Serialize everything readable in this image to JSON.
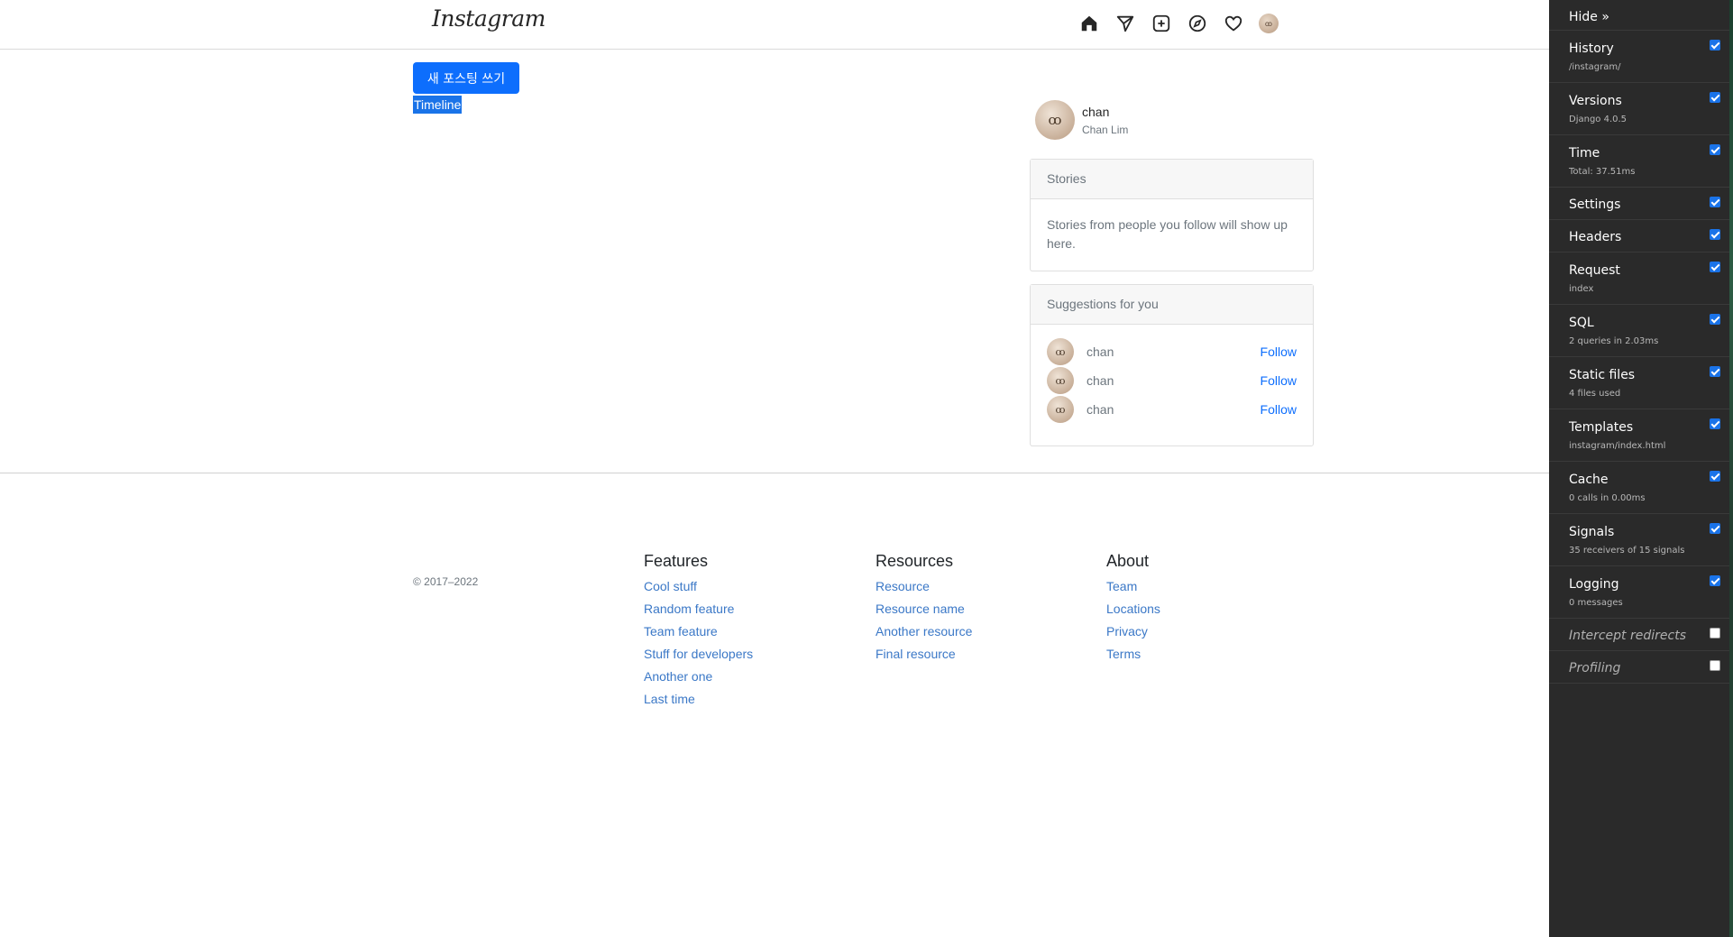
{
  "navbar": {
    "logo": "Instagram",
    "icons": [
      "home-icon",
      "send-icon",
      "plus-square-icon",
      "compass-icon",
      "heart-icon",
      "profile-avatar"
    ]
  },
  "main": {
    "new_post_button": "새 포스팅 쓰기",
    "timeline_label": "Timeline"
  },
  "profile": {
    "username": "chan",
    "name": "Chan Lim"
  },
  "stories": {
    "header": "Stories",
    "body": "Stories from people you follow will show up here."
  },
  "suggestions": {
    "header": "Suggestions for you",
    "items": [
      {
        "username": "chan",
        "action": "Follow"
      },
      {
        "username": "chan",
        "action": "Follow"
      },
      {
        "username": "chan",
        "action": "Follow"
      }
    ]
  },
  "footer": {
    "copyright": "© 2017–2022",
    "features": {
      "title": "Features",
      "links": [
        "Cool stuff",
        "Random feature",
        "Team feature",
        "Stuff for developers",
        "Another one",
        "Last time"
      ]
    },
    "resources": {
      "title": "Resources",
      "links": [
        "Resource",
        "Resource name",
        "Another resource",
        "Final resource"
      ]
    },
    "about": {
      "title": "About",
      "links": [
        "Team",
        "Locations",
        "Privacy",
        "Terms"
      ]
    }
  },
  "debug_toolbar": {
    "hide": "Hide »",
    "panels": [
      {
        "title": "History",
        "sub": "/instagram/",
        "checked": true
      },
      {
        "title": "Versions",
        "sub": "Django 4.0.5",
        "checked": true
      },
      {
        "title": "Time",
        "sub": "Total: 37.51ms",
        "checked": true
      },
      {
        "title": "Settings",
        "sub": "",
        "checked": true
      },
      {
        "title": "Headers",
        "sub": "",
        "checked": true
      },
      {
        "title": "Request",
        "sub": "index",
        "checked": true
      },
      {
        "title": "SQL",
        "sub": "2 queries in 2.03ms",
        "checked": true
      },
      {
        "title": "Static files",
        "sub": "4 files used",
        "checked": true
      },
      {
        "title": "Templates",
        "sub": "instagram/index.html",
        "checked": true
      },
      {
        "title": "Cache",
        "sub": "0 calls in 0.00ms",
        "checked": true
      },
      {
        "title": "Signals",
        "sub": "35 receivers of 15 signals",
        "checked": true
      },
      {
        "title": "Logging",
        "sub": "0 messages",
        "checked": true
      },
      {
        "title": "Intercept redirects",
        "sub": "",
        "checked": false
      },
      {
        "title": "Profiling",
        "sub": "",
        "checked": false
      }
    ]
  }
}
